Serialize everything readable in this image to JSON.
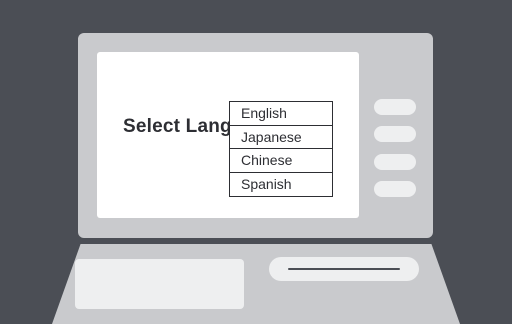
{
  "screen": {
    "title": "Select Language",
    "languages": [
      "English",
      "Japanese",
      "Chinese",
      "Spanish"
    ]
  },
  "colors": {
    "background": "#4b4e55",
    "machine_body": "#c9cacd",
    "screen": "#ffffff",
    "text": "#2d2e33",
    "keys": "#eeeff0"
  }
}
